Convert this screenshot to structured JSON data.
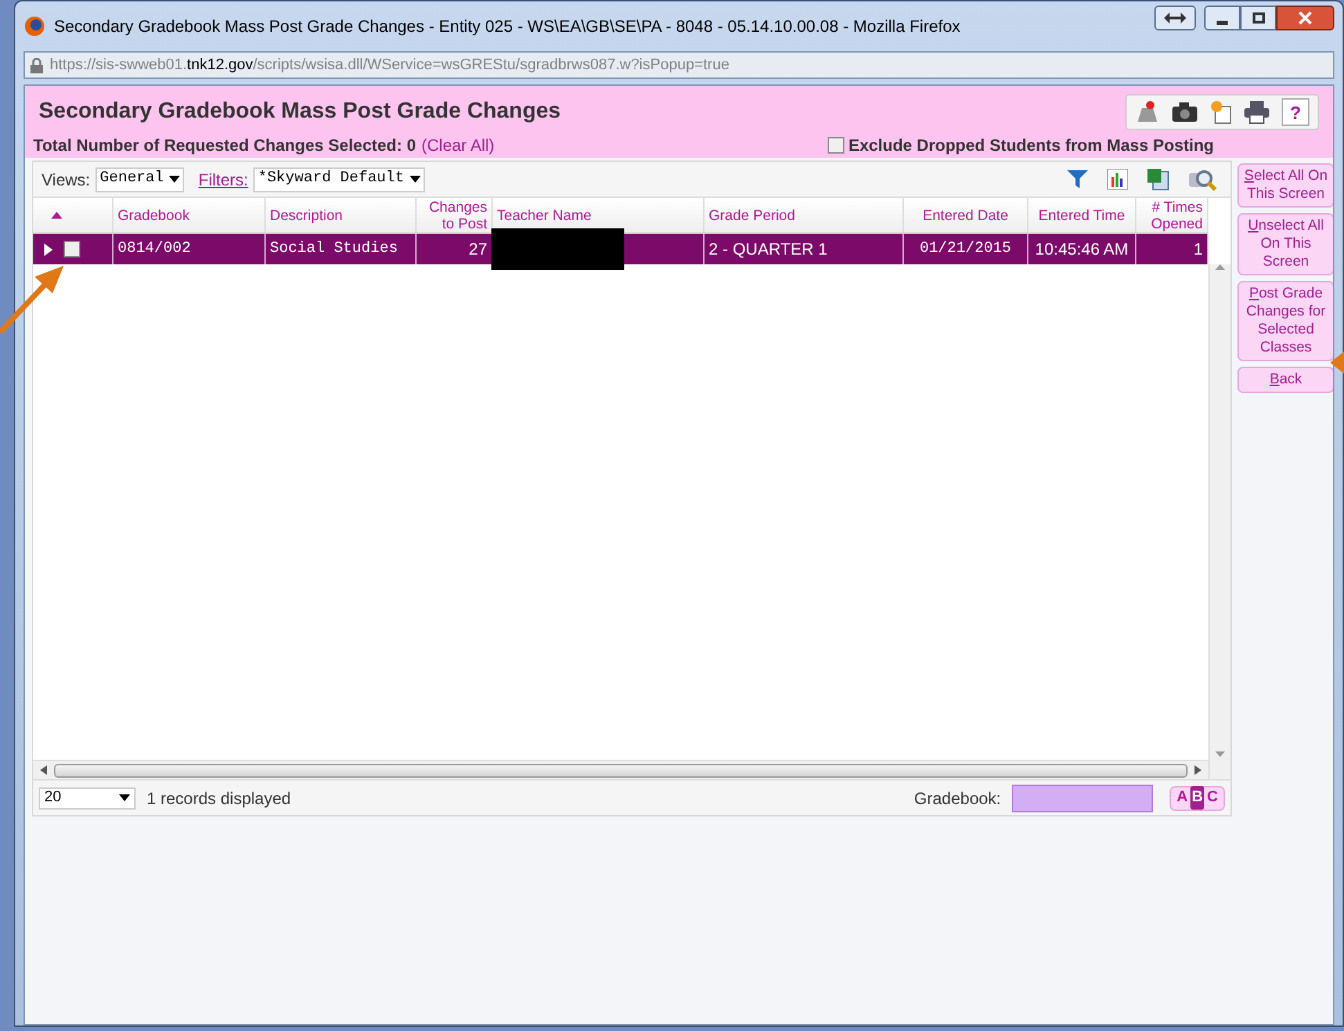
{
  "window": {
    "title": "Secondary Gradebook Mass Post Grade Changes - Entity 025 - WS\\EA\\GB\\SE\\PA - 8048 - 05.14.10.00.08 - Mozilla Firefox",
    "url_prefix": "https://sis-swweb01.",
    "url_domain": "tnk12.gov",
    "url_path": "/scripts/wsisa.dll/WService=wsGREStu/sgradbrws087.w?isPopup=true"
  },
  "page": {
    "title": "Secondary Gradebook Mass Post Grade Changes",
    "total_label": "Total Number of Requested Changes Selected: 0",
    "clear_all": "(Clear All)",
    "help": "?",
    "exclude_dropped": {
      "label": "Exclude Dropped Students from Mass Posting",
      "checked": false
    }
  },
  "toolbar": {
    "views_label": "Views:",
    "views_value": "General",
    "filters_label": "Filters:",
    "filters_value": "*Skyward Default"
  },
  "table": {
    "columns": [
      "Gradebook",
      "Description",
      "Changes to Post",
      "Teacher Name",
      "Grade Period",
      "Entered Date",
      "Entered Time",
      "# Times Opened"
    ],
    "rows": [
      {
        "selected": true,
        "checked": false,
        "gradebook": "0814/002",
        "description": "Social Studies",
        "changes": "27",
        "grade_period": "2 - QUARTER 1",
        "entered_date": "01/21/2015",
        "entered_time": "10:45:46 AM",
        "times_opened": "1"
      }
    ]
  },
  "footer": {
    "page_size": "20",
    "records": "1 records displayed",
    "gradebook_label": "Gradebook:",
    "abc": [
      {
        "text": "A",
        "selected": false
      },
      {
        "text": "B",
        "selected": true
      },
      {
        "text": "C",
        "selected": false
      }
    ]
  },
  "side_buttons": [
    "Select All On This Screen",
    "Unselect All On This Screen",
    "Post Grade Changes for Selected Classes",
    "Back"
  ]
}
